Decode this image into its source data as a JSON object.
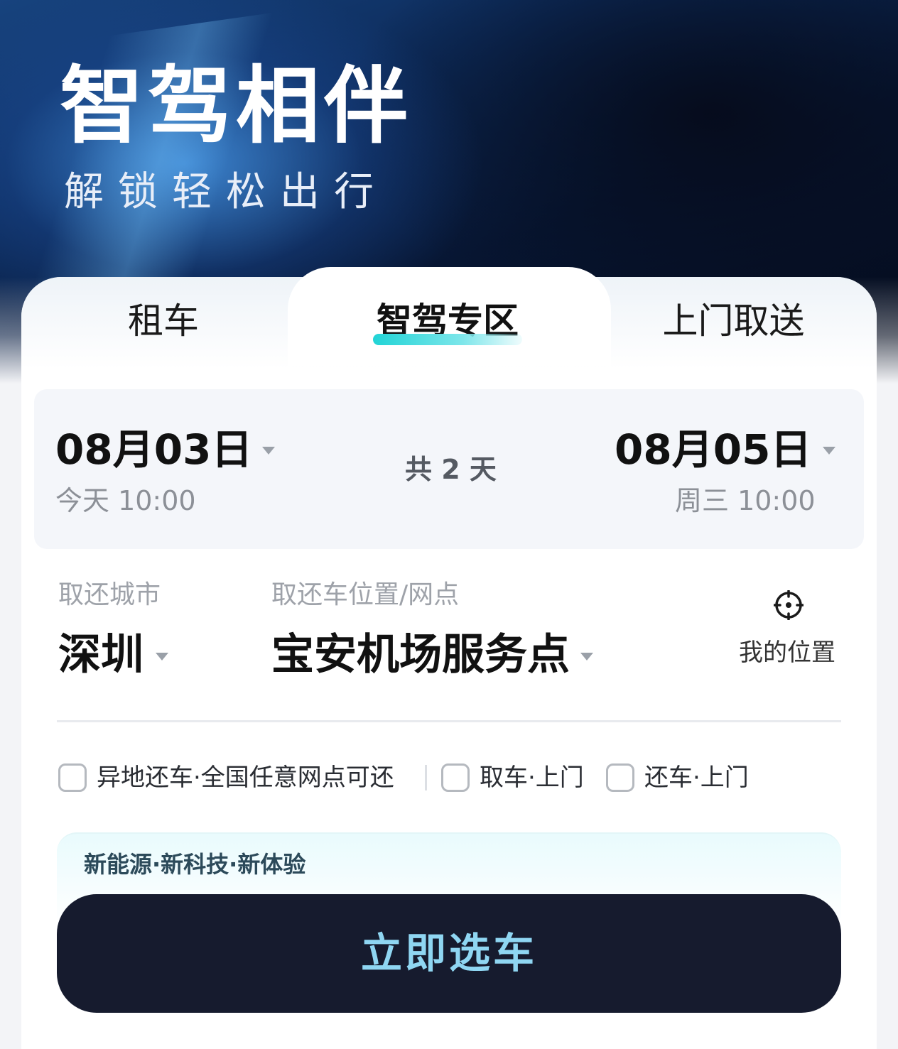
{
  "hero": {
    "title": "智驾相伴",
    "subtitle": "解锁轻松出行"
  },
  "tabs": [
    {
      "label": "租车",
      "active": false
    },
    {
      "label": "智驾专区",
      "active": true
    },
    {
      "label": "上门取送",
      "active": false
    }
  ],
  "dates": {
    "pickup_date": "08月03日",
    "pickup_time": "今天 10:00",
    "return_date": "08月05日",
    "return_time": "周三 10:00",
    "total_days": "共 2 天"
  },
  "location": {
    "city_label": "取还城市",
    "city_value": "深圳",
    "station_label": "取还车位置/网点",
    "station_value": "宝安机场服务点",
    "my_location_label": "我的位置"
  },
  "options": [
    {
      "label": "异地还车·全国任意网点可还",
      "checked": false
    },
    {
      "label": "取车·上门",
      "checked": false
    },
    {
      "label": "还车·上门",
      "checked": false
    }
  ],
  "promo": {
    "text": "新能源·新科技·新体验"
  },
  "cta": {
    "label": "立即选车"
  },
  "colors": {
    "accent_cyan": "#21d4d6",
    "cta_background": "#161b2e",
    "cta_text": "#8fd6f2"
  }
}
